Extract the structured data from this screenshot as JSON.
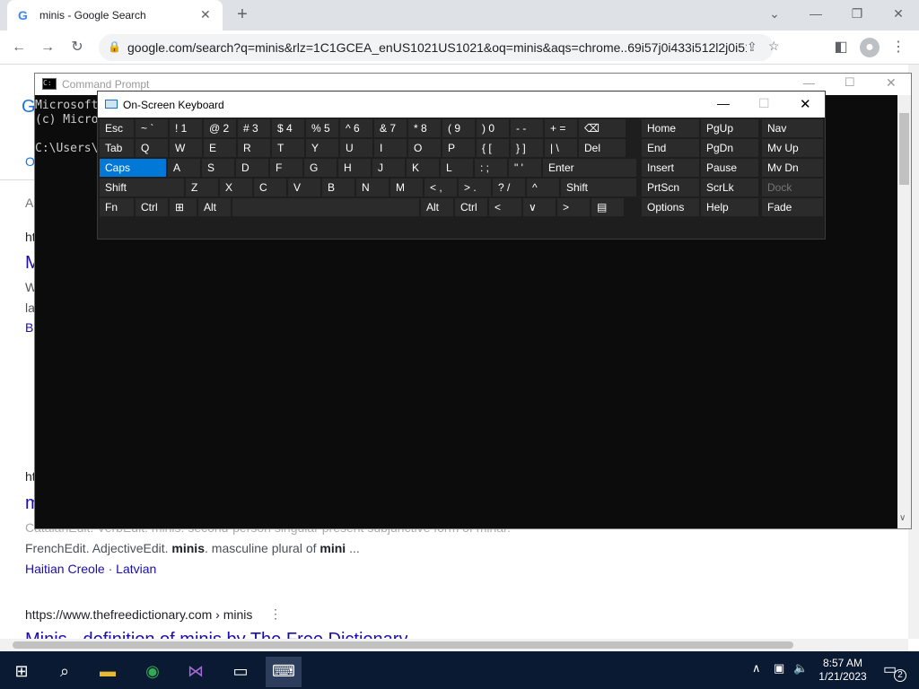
{
  "browser": {
    "tab_title": "minis - Google Search",
    "new_tab": "+",
    "url": "google.com/search?q=minis&rlz=1C1GCEA_enUS1021US1021&oq=minis&aqs=chrome..69i57j0i433i512l2j0i512..."
  },
  "page": {
    "partial_line1": "Catalan",
    "def1": "Edit. VerbEdit. minis. second-person singular present subjunctive form of minar.",
    "def2_pre": "FrenchEdit. AdjectiveEdit. ",
    "def2_bold": "minis",
    "def2_post": ". masculine plural of ",
    "def2_bold2": "mini",
    "def2_end": " ...",
    "link_a": "Haitian Creole",
    "sep": "·",
    "link_b": "Latvian",
    "result_url": "https://www.thefreedictionary.com › minis",
    "result_title": "Minis - definition of minis by The Free Dictionary",
    "frag_h1": "ht",
    "frag_m1": "M",
    "frag_a": "A",
    "frag_o": "O",
    "frag_w": "W",
    "frag_la": "la",
    "frag_b": "B",
    "frag_h2": "ht",
    "frag_m2": "m"
  },
  "cmd": {
    "title": "Command Prompt",
    "line1": "Microsoft",
    "line2": "(c) Micro",
    "line3": "C:\\Users\\"
  },
  "osk": {
    "title": "On-Screen Keyboard",
    "row1": [
      [
        "Esc",
        ""
      ],
      [
        "~ `",
        ""
      ],
      [
        "! 1",
        ""
      ],
      [
        "@ 2",
        ""
      ],
      [
        "# 3",
        ""
      ],
      [
        "$ 4",
        ""
      ],
      [
        "% 5",
        ""
      ],
      [
        "^ 6",
        ""
      ],
      [
        "& 7",
        ""
      ],
      [
        "* 8",
        ""
      ],
      [
        "( 9",
        ""
      ],
      [
        ") 0",
        ""
      ],
      [
        "- -",
        ""
      ],
      [
        "+ =",
        ""
      ],
      [
        "⌫",
        ""
      ]
    ],
    "row2": [
      "Tab",
      "Q",
      "W",
      "E",
      "R",
      "T",
      "Y",
      "U",
      "I",
      "O",
      "P",
      "{ [",
      "} ]",
      "| \\",
      "Del"
    ],
    "row3": [
      "Caps",
      "A",
      "S",
      "D",
      "F",
      "G",
      "H",
      "J",
      "K",
      "L",
      ": ;",
      "\" '",
      "Enter"
    ],
    "row4": [
      "Shift",
      "Z",
      "X",
      "C",
      "V",
      "B",
      "N",
      "M",
      "< ,",
      "> .",
      "? /",
      "^",
      "Shift"
    ],
    "row5": [
      "Fn",
      "Ctrl",
      "⊞",
      "Alt",
      "",
      "Alt",
      "Ctrl",
      "<",
      "∨",
      ">",
      "▤"
    ],
    "nav": [
      [
        "Home",
        "PgUp",
        "Nav"
      ],
      [
        "End",
        "PgDn",
        "Mv Up"
      ],
      [
        "Insert",
        "Pause",
        "Mv Dn"
      ],
      [
        "PrtScn",
        "ScrLk",
        "Dock"
      ],
      [
        "Options",
        "Help",
        "Fade"
      ]
    ]
  },
  "taskbar": {
    "time": "8:57 AM",
    "date": "1/21/2023",
    "notif_count": "2"
  }
}
